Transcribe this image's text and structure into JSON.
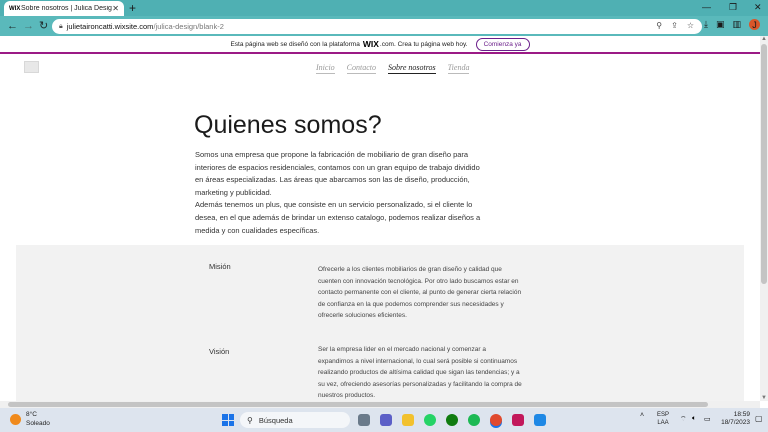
{
  "browser": {
    "tab_title": "Sobre nosotros | Julica Design",
    "tab_favicon": "WIX",
    "new_tab": "+",
    "url_host": "julietaironcatti.wixsite.com",
    "url_path": "/julica-design/blank-2",
    "profile_initial": "J"
  },
  "wix_banner": {
    "text_before": "Esta página web se diseñó con la plataforma",
    "logo": "WIX",
    "text_after": ".com. Crea tu página web hoy.",
    "button": "Comienza ya"
  },
  "nav": {
    "items": [
      {
        "label": "Inicio"
      },
      {
        "label": "Contacto"
      },
      {
        "label": "Sobre nosotros"
      },
      {
        "label": "Tienda"
      }
    ]
  },
  "main": {
    "heading": "Quienes somos?",
    "intro_p1": "Somos una empresa que propone la fabricación de mobiliario de gran diseño para interiores de espacios residenciales, contamos con un gran equipo de trabajo dividido en áreas especializadas. Las áreas que abarcamos son las de diseño, producción, marketing y publicidad.",
    "intro_p2": "Además tenemos un plus, que consiste en un servicio personalizado, si el cliente lo desea, en el que además de brindar un extenso catalogo, podemos realizar diseños a medida y con cualidades específicas."
  },
  "section": {
    "mision_label": "Misión",
    "mision_text": "Ofrecerle a los clientes mobiliarios de gran diseño y calidad que cuenten con innovación tecnológica. Por otro lado buscamos estar en contacto permanente con el cliente, al punto de generar cierta relación de confianza en la que podemos comprender sus necesidades y ofrecerle soluciones eficientes.",
    "vision_label": "Visión",
    "vision_text": "Ser la empresa lider en el mercado nacional y comenzar a expandirnos a nivel internacional, lo cual será posible si continuamos realizando productos de altísima calidad que sigan las tendencias; y a su vez, ofreciendo asesorías personalizadas y facilitando la compra de nuestros productos."
  },
  "taskbar": {
    "temp": "8°C",
    "weather": "Soleado",
    "search": "Búsqueda",
    "lang_1": "ESP",
    "lang_2": "LAA",
    "time": "18:59",
    "date": "18/7/2023"
  },
  "colors": {
    "chrome_tabbar": "#4fb0b3",
    "chrome_toolbar": "#5ab9bb",
    "wix_accent": "#9b1a86",
    "section_bg": "#f2f2f2"
  }
}
